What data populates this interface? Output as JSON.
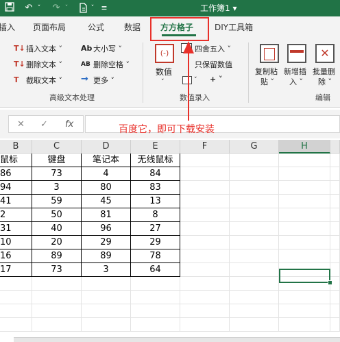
{
  "window": {
    "title": "工作簿1 ▾"
  },
  "quick_access": {
    "save_icon": "save-icon",
    "undo_icon": "undo-icon",
    "redo_icon": "redo-icon",
    "touch_icon": "touch-mode-icon",
    "customize_icon": "customize-icon"
  },
  "tabs": [
    "插入",
    "页面布局",
    "公式",
    "数据",
    "方方格子",
    "DIY工具箱"
  ],
  "active_tab": "方方格子",
  "ribbon": {
    "text_group": {
      "label": "高级文本处理",
      "items": [
        "插入文本 ˅",
        "删除文本 ˅",
        "截取文本 ˅"
      ],
      "items2": [
        "大小写 ˅",
        "删除空格 ˅",
        "更多 ˅"
      ],
      "icons1": [
        "T↓",
        "T↓",
        "T"
      ],
      "icons2": [
        "Ab",
        "AB"
      ]
    },
    "number_group": {
      "label": "数值录入",
      "big_label": "数值",
      "big_arrow": "˅",
      "items": [
        "四舍五入 ˅",
        "只保留数值"
      ],
      "plus": "+ ˅",
      "small_icon_1": "˅"
    },
    "edit_group": {
      "label": "编辑",
      "buttons": [
        {
          "l1": "复制粘",
          "l2": "贴 ˅"
        },
        {
          "l1": "新增插",
          "l2": "入 ˅"
        },
        {
          "l1": "批量删",
          "l2": "除 ˅"
        }
      ]
    }
  },
  "formula_bar": {
    "cancel": "✕",
    "confirm": "✓",
    "fx": "fx"
  },
  "annotation": "百度它，即可下载安装",
  "columns": [
    "B",
    "C",
    "D",
    "E",
    "F",
    "G",
    "H"
  ],
  "table": {
    "headers": [
      "鼠标",
      "键盘",
      "笔记本",
      "无线鼠标"
    ],
    "rows": [
      [
        "86",
        "73",
        "4",
        "84"
      ],
      [
        "94",
        "3",
        "80",
        "83"
      ],
      [
        "41",
        "59",
        "45",
        "13"
      ],
      [
        "2",
        "50",
        "81",
        "8"
      ],
      [
        "31",
        "40",
        "96",
        "27"
      ],
      [
        "10",
        "20",
        "29",
        "29"
      ],
      [
        "16",
        "89",
        "89",
        "78"
      ],
      [
        "17",
        "73",
        "3",
        "64"
      ]
    ]
  },
  "colors": {
    "excel_green": "#217346",
    "annotation_red": "#e8302a"
  }
}
